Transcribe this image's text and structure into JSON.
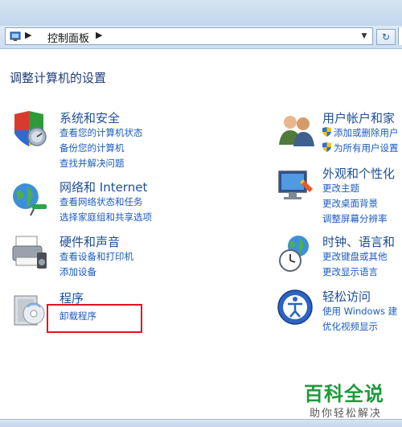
{
  "address_bar": {
    "path": [
      "控制面板"
    ],
    "dropdown_icon": "chevron-down-icon",
    "refresh_icon": "refresh-icon"
  },
  "heading": "调整计算机的设置",
  "categories_left": [
    {
      "icon": "system-security-icon",
      "title": "系统和安全",
      "links": [
        "查看您的计算机状态",
        "备份您的计算机",
        "查找并解决问题"
      ]
    },
    {
      "icon": "network-internet-icon",
      "title": "网络和 Internet",
      "links": [
        "查看网络状态和任务",
        "选择家庭组和共享选项"
      ]
    },
    {
      "icon": "hardware-sound-icon",
      "title": "硬件和声音",
      "links": [
        "查看设备和打印机",
        "添加设备"
      ]
    },
    {
      "icon": "programs-icon",
      "title": "程序",
      "links": [
        "卸载程序"
      ]
    }
  ],
  "categories_right": [
    {
      "icon": "user-accounts-icon",
      "title": "用户帐户和家",
      "links": [
        "添加或删除用户",
        "为所有用户设置"
      ]
    },
    {
      "icon": "appearance-icon",
      "title": "外观和个性化",
      "links": [
        "更改主题",
        "更改桌面背景",
        "调整屏幕分辨率"
      ]
    },
    {
      "icon": "clock-region-icon",
      "title": "时钟、语言和",
      "links": [
        "更改键盘或其他",
        "更改显示语言"
      ]
    },
    {
      "icon": "ease-of-access-icon",
      "title": "轻松访问",
      "links": [
        "使用 Windows 建",
        "优化视频显示"
      ]
    }
  ],
  "watermark": {
    "title": "百科全说",
    "subtitle": "助你轻松解决"
  },
  "colors": {
    "link": "#1a5bc4",
    "title": "#1e4e9a",
    "highlight": "#e0141e",
    "watermark": "#1e9a3a"
  }
}
